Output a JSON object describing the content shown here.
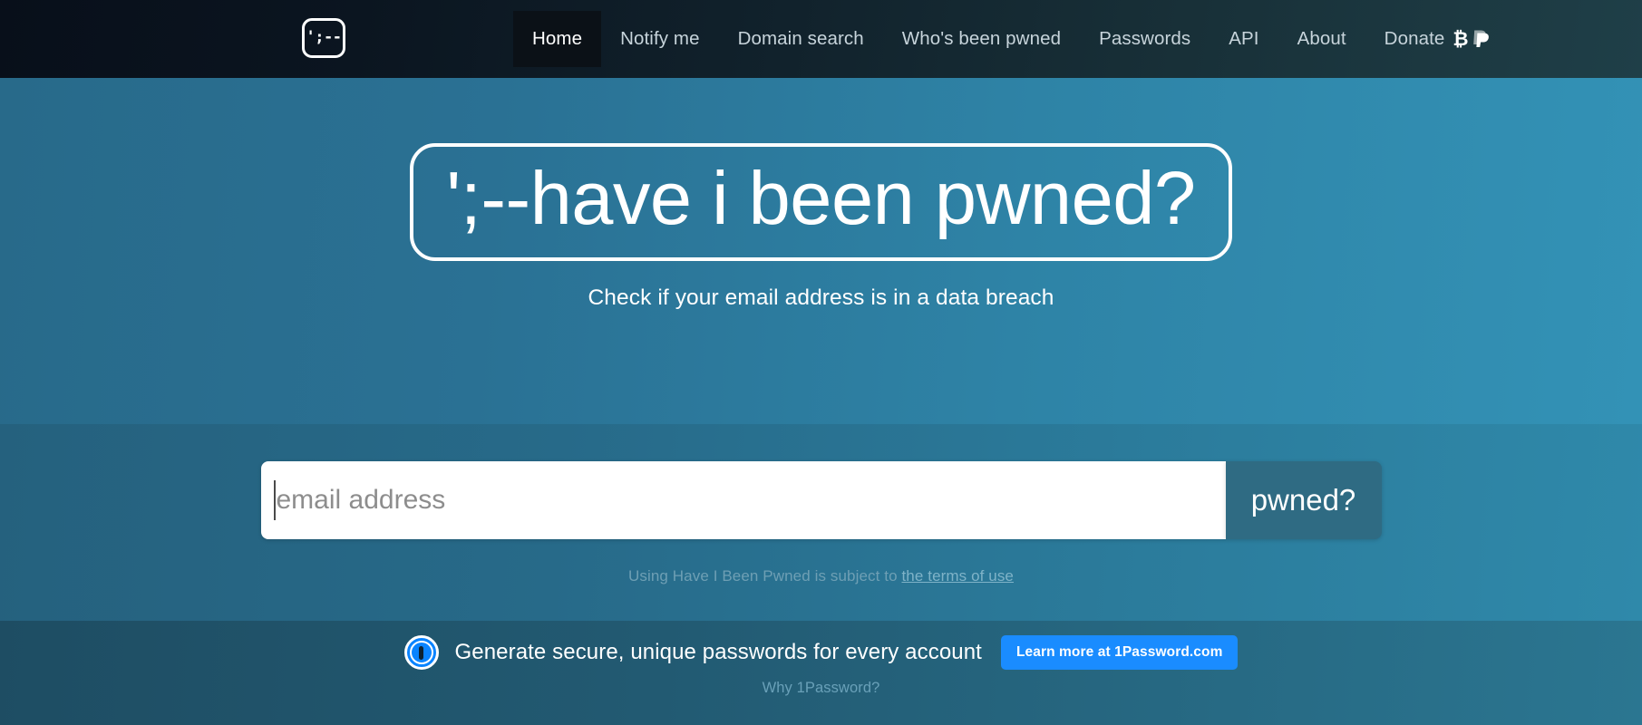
{
  "nav": {
    "logo_text": "';--",
    "logo_name": "have-i-been-pwned-logo",
    "items": [
      {
        "label": "Home",
        "active": true
      },
      {
        "label": "Notify me",
        "active": false
      },
      {
        "label": "Domain search",
        "active": false
      },
      {
        "label": "Who's been pwned",
        "active": false
      },
      {
        "label": "Passwords",
        "active": false
      },
      {
        "label": "API",
        "active": false
      },
      {
        "label": "About",
        "active": false
      },
      {
        "label": "Donate",
        "active": false
      }
    ],
    "donate_icons": [
      "bitcoin-icon",
      "paypal-icon"
    ],
    "bitcoin_glyph": "₿",
    "paypal_glyph": "P"
  },
  "hero": {
    "title": "';--have i been pwned?",
    "subtitle": "Check if your email address is in a data breach"
  },
  "search": {
    "placeholder": "email address",
    "value": "",
    "button_label": "pwned?",
    "terms_prefix": "Using Have I Been Pwned is subject to ",
    "terms_link": "the terms of use"
  },
  "onepassword": {
    "logo_name": "1password-logo",
    "headline": "Generate secure, unique passwords for every account",
    "cta_label": "Learn more at 1Password.com",
    "why_link": "Why 1Password?"
  },
  "colors": {
    "nav_dark": "#080f1a",
    "nav_light": "#1f3f48",
    "hero_left": "#286a8a",
    "hero_right": "#3392b6",
    "pwned_button": "#2f6b83",
    "onepassword_blue": "#1a8cff",
    "accent_white": "#ffffff"
  }
}
